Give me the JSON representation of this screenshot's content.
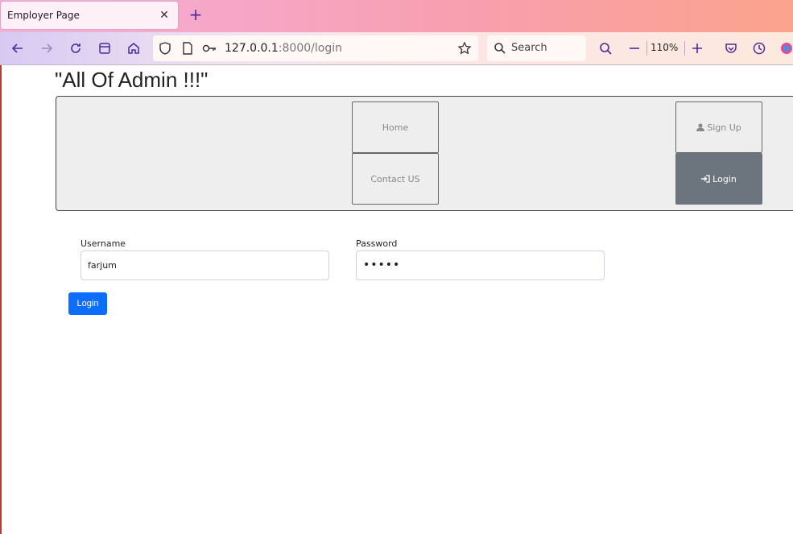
{
  "browser": {
    "tab_title": "Employer Page",
    "tab_close": "✕",
    "new_tab": "+",
    "url_host": "127.0.0.1",
    "url_path": ":8000/login",
    "search_placeholder": "Search",
    "zoom": "110%"
  },
  "page": {
    "heading": "\"All Of Admin !!!\"",
    "menu": {
      "home": "Home",
      "contact": "Contact US",
      "signup": "Sign Up",
      "login": "Login"
    },
    "form": {
      "username_label": "Username",
      "username_value": "farjum",
      "password_label": "Password",
      "password_value": "•••••",
      "submit_label": "Login"
    }
  },
  "colors": {
    "primary": "#0d6efd",
    "secondary": "#6c757d"
  }
}
